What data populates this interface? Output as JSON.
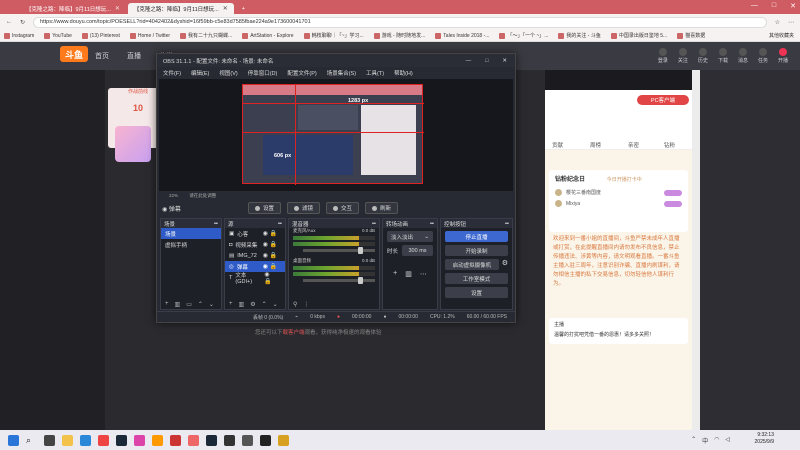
{
  "browser": {
    "tabs": [
      {
        "label": "【克隆之路：降临】9月11日想玩..."
      },
      {
        "label": "【克隆之路：降临】9月11日想玩..."
      }
    ],
    "url": "https://www.douyu.com/topic/POESELL?rid=4042402&dyshid=16f59bb-c5e83d7585fbae224a9e173600041701",
    "bookmarks": [
      "Instagram",
      "YouTube",
      "(13) Pinterest",
      "Home / Twitter",
      "我有二十九只蝴蝶...",
      "ArtStation - Explore",
      "韩枝聊聊｜「~」学习...",
      "游戏 - 随时随地发...",
      "Tales Inside 2018 -...",
      "「～」「一个 ~」...",
      "我的关注 - 斗鱼",
      "中国录出版日鉴地 5...",
      "猫喜数据"
    ],
    "bookmarks_right": "其他收藏夹",
    "window_controls": [
      "—",
      "□",
      "✕"
    ]
  },
  "site": {
    "logo": "斗鱼",
    "nav": [
      "首页",
      "直播",
      "分类"
    ],
    "icons": [
      "登录",
      "关注",
      "历史",
      "下载",
      "消息",
      "任务",
      "开播"
    ],
    "stream_card": {
      "label": "作战前线",
      "num": "10"
    },
    "hint_prefix": "您还可以下",
    "hint_link": "载客户端",
    "hint_suffix": "观看，获得纯净极速的观看体验"
  },
  "rpanel": {
    "pc_btn": "PC客户端",
    "tabs": [
      "贡献",
      "周榜",
      "亲密",
      "钻粉"
    ],
    "rank_title": "钻粉纪念日",
    "rank_sub": "今日开播打卡中",
    "rank_rows": [
      {
        "name": "樱花三番南国度"
      },
      {
        "name": "Mixiya"
      }
    ],
    "notice": "欢迎来到一番小姐的直播间，斗鱼严禁未成年人直播或打赏，在此提醒直播间内请勿发布不良信息，禁止传播违法、涉黄等内容，请文明观看直播。一番斗鱼主播入驻三周年，注意识别诈骗、直播内刷谋利，请勿相信主播的私下交易信息，切勿轻信他人谋利行为。",
    "chat_name": "主播",
    "chat_msg": "温馨的打扰吧凭借一番的恩惠！请多多关照！"
  },
  "obs": {
    "title": "OBS 31.1.1 - 配置文件: 未命名 - 场景: 未命名",
    "menu": [
      "文件(F)",
      "编辑(E)",
      "视图(V)",
      "停靠窗口(D)",
      "配置文件(P)",
      "场景集合(S)",
      "工具(T)",
      "帮助(H)"
    ],
    "preview_w_label": "1283 px",
    "preview_h_label": "606 px",
    "zoom": "22%",
    "zoom_hint": "请在此处调整",
    "scene_bar": {
      "current": "弹幕",
      "settings": "设置",
      "filters": "滤镜",
      "interact": "交互",
      "refresh": "刷新"
    },
    "docks": {
      "scenes": {
        "title": "场景",
        "items": [
          "场景",
          "虚拟手柄"
        ]
      },
      "sources": {
        "title": "源",
        "items": [
          "心客",
          "视频采集",
          "IMG_72",
          "弹幕",
          "文本 (GDI+)"
        ]
      },
      "mixer": {
        "title": "混音器",
        "tracks": [
          {
            "name": "麦克风/Aux",
            "db": "0.0 dB"
          },
          {
            "name": "桌面音频",
            "db": "0.0 dB"
          }
        ]
      },
      "transitions": {
        "title": "转场动画",
        "type": "淡入淡出",
        "duration_label": "时长",
        "duration": "300 ms"
      },
      "controls": {
        "title": "控制按钮",
        "buttons": [
          "停止直播",
          "开始录制",
          "启动虚拟摄像机",
          "工作室模式",
          "设置"
        ]
      }
    },
    "status": {
      "dropped": "丢帧 0 (0.0%)",
      "bitrate": "0 kbps",
      "time1": "00:00:00",
      "time2": "00:00:00",
      "cpu": "CPU: 1.2%",
      "fps": "60.00 / 60.00 FPS"
    }
  },
  "taskbar": {
    "time": "9:32:13",
    "date": "2025/9/9",
    "lang": "中"
  }
}
